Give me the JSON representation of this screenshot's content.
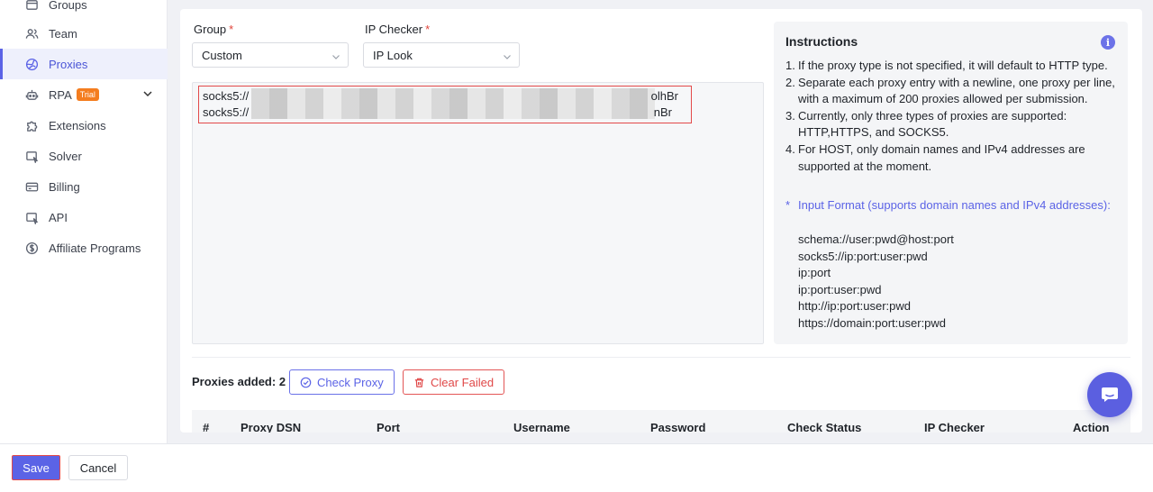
{
  "sidebar": {
    "items": [
      {
        "label": "Groups",
        "icon": "folder-icon"
      },
      {
        "label": "Team",
        "icon": "users-icon"
      },
      {
        "label": "Proxies",
        "icon": "globe-icon",
        "active": true
      },
      {
        "label": "RPA",
        "icon": "robot-icon",
        "badge": "Trial"
      },
      {
        "label": "Extensions",
        "icon": "puzzle-icon"
      },
      {
        "label": "Solver",
        "icon": "solver-icon"
      },
      {
        "label": "Billing",
        "icon": "card-icon"
      },
      {
        "label": "API",
        "icon": "api-icon"
      },
      {
        "label": "Affiliate Programs",
        "icon": "dollar-icon"
      }
    ]
  },
  "form": {
    "group_label": "Group",
    "group_required": "*",
    "group_value": "Custom",
    "checker_label": "IP Checker",
    "checker_required": "*",
    "checker_value": "IP Look",
    "proxies": [
      {
        "prefix": "socks5://",
        "suffix": "olhBr"
      },
      {
        "prefix": "socks5://",
        "suffix": "nBr"
      }
    ]
  },
  "instructions": {
    "title": "Instructions",
    "info_glyph": "i",
    "items": [
      {
        "num": "1.",
        "text": "If the proxy type is not specified, it will default to HTTP type."
      },
      {
        "num": "2.",
        "text": "Separate each proxy entry with a newline, one proxy per line, with a maximum of 200 proxies allowed per submission."
      },
      {
        "num": "3.",
        "text": "Currently, only three types of proxies are supported: HTTP,HTTPS, and SOCKS5."
      },
      {
        "num": "4.",
        "text": "For HOST, only domain names and IPv4 addresses are supported at the moment."
      }
    ],
    "format_star": "*",
    "format_heading": "Input Format (supports domain names and IPv4 addresses):",
    "formats": [
      "schema://user:pwd@host:port",
      "socks5://ip:port:user:pwd",
      "ip:port",
      "ip:port:user:pwd",
      "http://ip:port:user:pwd",
      "https://domain:port:user:pwd"
    ]
  },
  "summary": {
    "added_label": "Proxies added:",
    "added_count": "2",
    "check_button": "Check Proxy",
    "clear_button": "Clear Failed"
  },
  "table": {
    "columns": [
      "#",
      "Proxy DSN",
      "Port",
      "Username",
      "Password",
      "Check Status",
      "IP Checker",
      "Action"
    ]
  },
  "footer": {
    "save": "Save",
    "cancel": "Cancel"
  },
  "colors": {
    "accent": "#5b63e6",
    "danger": "#e34a4a",
    "trial_badge": "#f47d1f"
  }
}
